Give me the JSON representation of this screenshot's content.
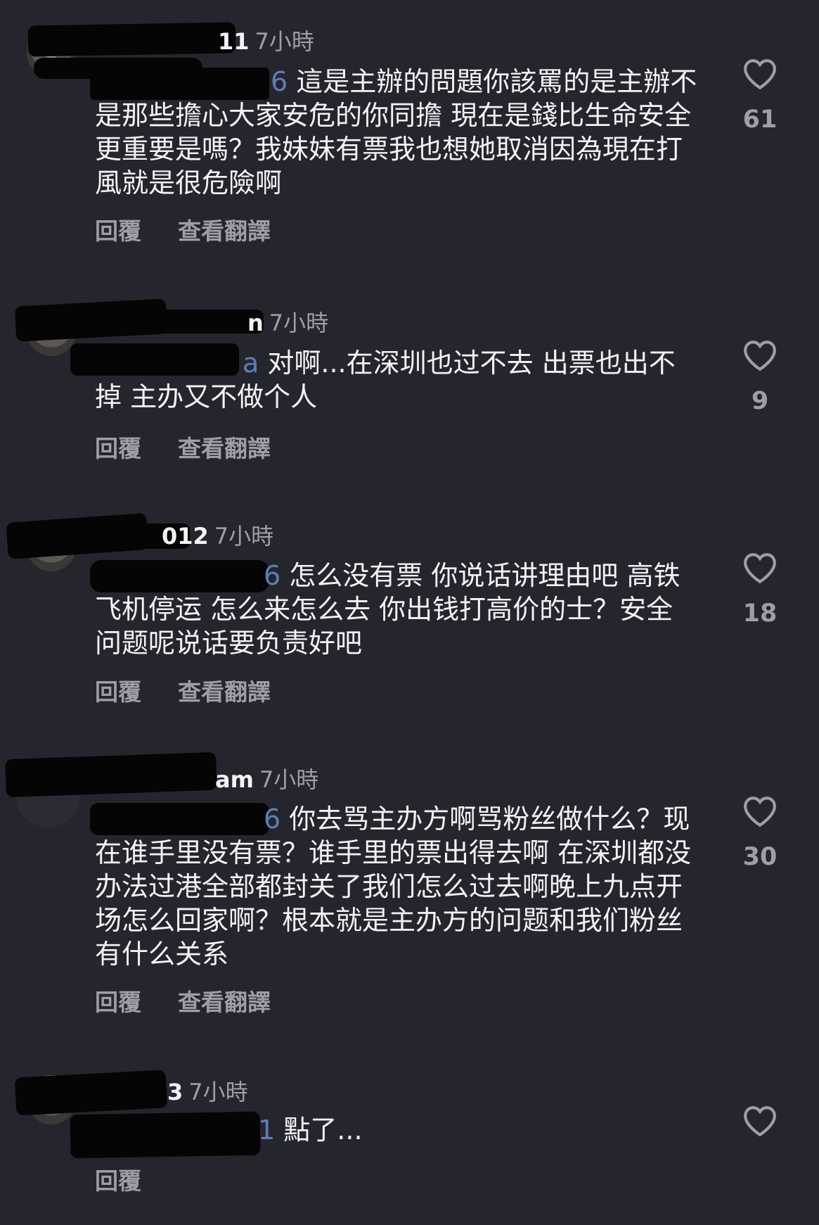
{
  "colors": {
    "background": "#25262d",
    "primary_text": "#f3f3f5",
    "secondary_text": "#9e9fa6",
    "mention": "#5e7fb6",
    "redaction": "#050506",
    "story_ring": [
      "#ff9d1a",
      "#e8204f",
      "#c4208f"
    ]
  },
  "comments": [
    {
      "username_visible": "11",
      "time": "7小時",
      "mention_visible": "6",
      "text": "這是主辦的問題你該罵的是主辦不是那些擔心大家安危的你同擔 現在是錢比生命安全更重要是嗎？我妹妹有票我也想她取消因為現在打風就是很危險啊",
      "reply_label": "回覆",
      "translate_label": "查看翻譯",
      "likes": "61",
      "like_icon": "heart-outline-icon"
    },
    {
      "username_visible": "n",
      "time": "7小時",
      "mention_visible": "a",
      "text": "对啊...在深圳也过不去 出票也出不掉 主办又不做个人",
      "reply_label": "回覆",
      "translate_label": "查看翻譯",
      "likes": "9",
      "like_icon": "heart-outline-icon"
    },
    {
      "username_visible": "012",
      "time": "7小時",
      "mention_visible": "6",
      "text": "怎么没有票 你说话讲理由吧 高铁飞机停运 怎么来怎么去 你出钱打高价的士？安全问题呢说话要负责好吧",
      "reply_label": "回覆",
      "translate_label": "查看翻譯",
      "likes": "18",
      "like_icon": "heart-outline-icon"
    },
    {
      "username_visible": "am",
      "time": "7小時",
      "mention_visible": "6",
      "text": "你去骂主办方啊骂粉丝做什么？现在谁手里没有票？谁手里的票出得去啊 在深圳都没办法过港全部都封关了我们怎么过去啊晚上九点开场怎么回家啊？根本就是主办方的问题和我们粉丝有什么关系",
      "reply_label": "回覆",
      "translate_label": "查看翻譯",
      "likes": "30",
      "like_icon": "heart-outline-icon"
    },
    {
      "username_visible": "3",
      "time": "7小時",
      "mention_visible": "1",
      "text": "點了...",
      "reply_label": "回覆",
      "likes": "",
      "like_icon": "heart-outline-icon"
    }
  ]
}
